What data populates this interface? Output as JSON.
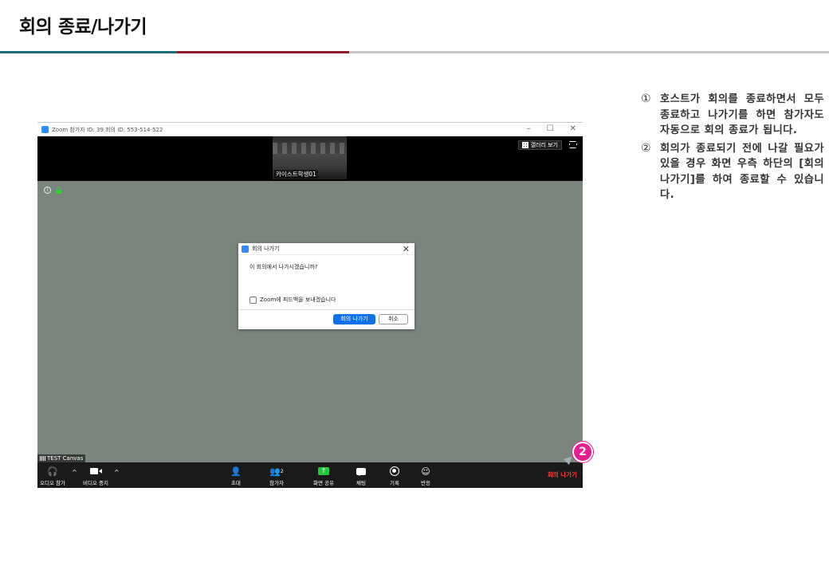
{
  "slide": {
    "title": "회의 종료/나가기",
    "notes": [
      {
        "num": "①",
        "text": "호스트가 회의를 종료하면서 모두 종료하고 나가기를 하면 참가자도 자동으로 회의 종료가 됩니다."
      },
      {
        "num": "②",
        "text": "회의가 종료되기 전에 나갈 필요가 있을 경우 화면 우측 하단의 [회의 나가기]를 하여 종료할 수 있습니다."
      }
    ],
    "step_marker": "2"
  },
  "zoom": {
    "window_title": "Zoom 참가자 ID: 39   회의 ID: 553-514-522",
    "window_controls": {
      "minimize": "–",
      "maximize": "☐",
      "close": "✕"
    },
    "thumbnail_label": "카이스트학생01",
    "gallery_view": "갤러리 보기",
    "info_symbol": "i",
    "network_label": "TEST Canvas",
    "dialog": {
      "title": "회의 나가기",
      "close": "✕",
      "message": "이 회의에서 나가시겠습니까?",
      "feedback_checkbox": "Zoom에 피드백을 보내겠습니다",
      "leave_button": "회의 나가기",
      "cancel_button": "취소"
    },
    "toolbar": {
      "audio": "오디오 참가",
      "video": "비디오 중지",
      "invite": "초대",
      "participants": "참가자",
      "participants_count": "2",
      "share": "화면 공유",
      "chat": "채팅",
      "record": "기록",
      "reactions": "반응",
      "leave": "회의 나가기",
      "caret": "^"
    },
    "colors": {
      "accent_blue": "#0e71eb",
      "share_green": "#23c93c",
      "leave_red": "#ff3b3b",
      "marker_pink": "#e81e8f"
    }
  }
}
